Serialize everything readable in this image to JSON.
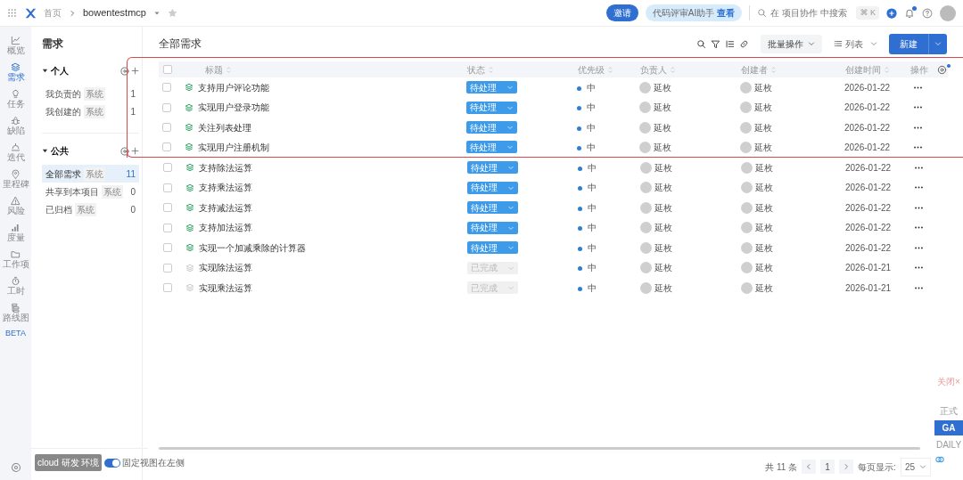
{
  "topbar": {
    "breadcrumb": [
      "首页",
      "bowentestmcp"
    ],
    "invite": "邀请",
    "ai_chip": {
      "label": "代码评审AI助手",
      "action": "查看"
    },
    "search": {
      "placeholder": "在 项目协作 中搜索"
    },
    "shortcut": "⌘ K",
    "notification": true
  },
  "rail": [
    {
      "label": "概览",
      "selected": false
    },
    {
      "label": "需求",
      "selected": true
    },
    {
      "label": "任务",
      "selected": false
    },
    {
      "label": "缺陷",
      "selected": false
    },
    {
      "label": "迭代",
      "selected": false
    },
    {
      "label": "里程碑",
      "selected": false
    },
    {
      "label": "风险",
      "selected": false
    },
    {
      "label": "度量",
      "selected": false
    },
    {
      "label": "工作项",
      "selected": false
    },
    {
      "label": "工时",
      "selected": false
    },
    {
      "label": "路线图",
      "selected": false,
      "badge": "BETA"
    }
  ],
  "sidebar": {
    "title": "需求",
    "groups": [
      {
        "label": "个人",
        "expanded": true,
        "items": [
          {
            "label": "我负责的",
            "tag": "系统",
            "count": "1",
            "selected": false
          },
          {
            "label": "我创建的",
            "tag": "系统",
            "count": "1",
            "selected": false
          }
        ]
      },
      {
        "label": "公共",
        "expanded": true,
        "items": [
          {
            "label": "全部需求",
            "tag": "系统",
            "count": "11",
            "selected": true
          },
          {
            "label": "共享到本项目",
            "tag": "系统",
            "count": "0",
            "selected": false
          },
          {
            "label": "已归档",
            "tag": "系统",
            "count": "0",
            "selected": false
          }
        ]
      }
    ],
    "pin_toggle": {
      "label": "固定视图在左侧",
      "on": true
    },
    "env_badge": "cloud 研发 环境"
  },
  "main": {
    "title": "全部需求",
    "batch": "批量操作",
    "view": "列表",
    "create": "新建"
  },
  "table": {
    "select_all_checked": false,
    "columns": [
      "标题",
      "状态",
      "优先级",
      "负责人",
      "创建者",
      "创建时间",
      "操作"
    ],
    "rows": [
      {
        "title": "支持用户评论功能",
        "status": "待处理",
        "kind": "open",
        "priority": "中",
        "assignee": "延枚",
        "creator": "延枚",
        "created": "2026-01-22",
        "highlighted": true
      },
      {
        "title": "实现用户登录功能",
        "status": "待处理",
        "kind": "open",
        "priority": "中",
        "assignee": "延枚",
        "creator": "延枚",
        "created": "2026-01-22",
        "highlighted": true
      },
      {
        "title": "关注列表处理",
        "status": "待处理",
        "kind": "open",
        "priority": "中",
        "assignee": "延枚",
        "creator": "延枚",
        "created": "2026-01-22",
        "highlighted": true
      },
      {
        "title": "实现用户注册机制",
        "status": "待处理",
        "kind": "open",
        "priority": "中",
        "assignee": "延枚",
        "creator": "延枚",
        "created": "2026-01-22",
        "highlighted": true
      },
      {
        "title": "支持除法运算",
        "status": "待处理",
        "kind": "open",
        "priority": "中",
        "assignee": "延枚",
        "creator": "延枚",
        "created": "2026-01-22",
        "highlighted": false
      },
      {
        "title": "支持乘法运算",
        "status": "待处理",
        "kind": "open",
        "priority": "中",
        "assignee": "延枚",
        "creator": "延枚",
        "created": "2026-01-22",
        "highlighted": false
      },
      {
        "title": "支持减法运算",
        "status": "待处理",
        "kind": "open",
        "priority": "中",
        "assignee": "延枚",
        "creator": "延枚",
        "created": "2026-01-22",
        "highlighted": false
      },
      {
        "title": "支持加法运算",
        "status": "待处理",
        "kind": "open",
        "priority": "中",
        "assignee": "延枚",
        "creator": "延枚",
        "created": "2026-01-22",
        "highlighted": false
      },
      {
        "title": "实现一个加减乘除的计算器",
        "status": "待处理",
        "kind": "open",
        "priority": "中",
        "assignee": "延枚",
        "creator": "延枚",
        "created": "2026-01-22",
        "highlighted": false
      },
      {
        "title": "实现除法运算",
        "status": "已完成",
        "kind": "done",
        "priority": "中",
        "assignee": "延枚",
        "creator": "延枚",
        "created": "2026-01-21",
        "highlighted": false
      },
      {
        "title": "实现乘法运算",
        "status": "已完成",
        "kind": "done",
        "priority": "中",
        "assignee": "延枚",
        "creator": "延枚",
        "created": "2026-01-21",
        "highlighted": false
      }
    ]
  },
  "pagination": {
    "total": "共 11 条",
    "page": "1",
    "size_label": "每页显示:",
    "size": "25"
  },
  "env_switch": {
    "close": "关闭×",
    "options": [
      {
        "label": "正式",
        "selected": false
      },
      {
        "label": "GA",
        "selected": true
      },
      {
        "label": "DAILY",
        "selected": false
      }
    ]
  }
}
